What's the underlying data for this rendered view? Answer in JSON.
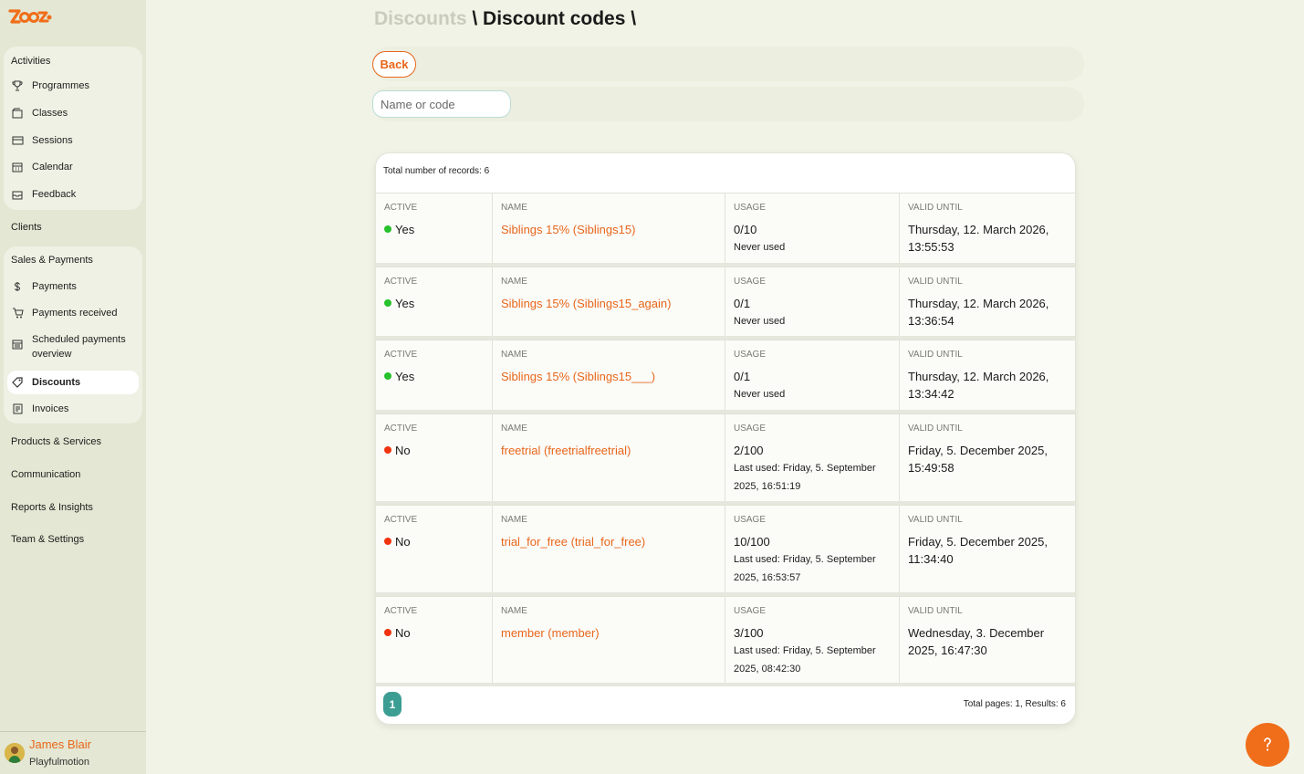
{
  "sidebar": {
    "logo_text": "Zooza",
    "activities": {
      "title": "Activities",
      "items": [
        {
          "label": "Programmes",
          "icon": "trophy-icon"
        },
        {
          "label": "Classes",
          "icon": "folder-icon"
        },
        {
          "label": "Sessions",
          "icon": "ticket-icon"
        },
        {
          "label": "Calendar",
          "icon": "calendar-icon"
        },
        {
          "label": "Feedback",
          "icon": "inbox-icon"
        }
      ]
    },
    "clients_label": "Clients",
    "sales": {
      "title": "Sales & Payments",
      "items": [
        {
          "label": "Payments",
          "icon": "coin-icon"
        },
        {
          "label": "Payments received",
          "icon": "cart-icon"
        },
        {
          "label": "Scheduled payments overview",
          "icon": "schedule-icon"
        },
        {
          "label": "Discounts",
          "icon": "tag-icon"
        },
        {
          "label": "Invoices",
          "icon": "invoice-icon"
        }
      ]
    },
    "products_label": "Products & Services",
    "communication_label": "Communication",
    "reports_label": "Reports & Insights",
    "team_label": "Team & Settings",
    "user": {
      "name": "James Blair",
      "org": "Playfulmotion"
    }
  },
  "header": {
    "crumb_parent": "Discounts",
    "crumb_sep1": " \\ ",
    "crumb_current": "Discount codes",
    "crumb_sep2": " \\"
  },
  "toolbar": {
    "back_label": "Back",
    "search_placeholder": "Name or code"
  },
  "table": {
    "total_records": "Total number of records: 6",
    "headers": {
      "active": "ACTIVE",
      "name": "NAME",
      "usage": "USAGE",
      "valid_until": "VALID UNTIL"
    },
    "rows": [
      {
        "active": "Yes",
        "status_color": "#26c12c",
        "name": "Siblings 15% (Siblings15)",
        "usage": "0/10",
        "usage_note": "Never used",
        "valid_until": "Thursday, 12. March 2026, 13:55:53"
      },
      {
        "active": "Yes",
        "status_color": "#26c12c",
        "name": "Siblings 15% (Siblings15_again)",
        "usage": "0/1",
        "usage_note": "Never used",
        "valid_until": "Thursday, 12. March 2026, 13:36:54"
      },
      {
        "active": "Yes",
        "status_color": "#26c12c",
        "name": "Siblings 15% (Siblings15___)",
        "usage": "0/1",
        "usage_note": "Never used",
        "valid_until": "Thursday, 12. March 2026, 13:34:42"
      },
      {
        "active": "No",
        "status_color": "#f2330f",
        "name": "freetrial (freetrialfreetrial)",
        "usage": "2/100",
        "usage_note": "Last used: Friday, 5. September 2025, 16:51:19",
        "valid_until": "Friday, 5. December 2025, 15:49:58"
      },
      {
        "active": "No",
        "status_color": "#f2330f",
        "name": "trial_for_free (trial_for_free)",
        "usage": "10/100",
        "usage_note": "Last used: Friday, 5. September 2025, 16:53:57",
        "valid_until": "Friday, 5. December 2025, 11:34:40"
      },
      {
        "active": "No",
        "status_color": "#f2330f",
        "name": "member (member)",
        "usage": "3/100",
        "usage_note": "Last used: Friday, 5. September 2025, 08:42:30",
        "valid_until": "Wednesday, 3. December 2025, 16:47:30"
      }
    ]
  },
  "pagination": {
    "current_page": "1",
    "info": "Total pages: 1, Results: 6"
  },
  "colors": {
    "accent": "#e8661a",
    "teal": "#3c9e93",
    "active_green": "#26c12c",
    "inactive_red": "#f2330f"
  }
}
